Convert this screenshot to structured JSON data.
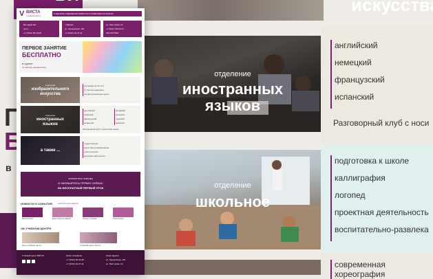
{
  "background": {
    "top_photo_text": "искусства",
    "left": {
      "logo_text": "ВИСТ",
      "big_line_1": "П",
      "big_line_2": "Б",
      "small_text": "в"
    },
    "section_languages": {
      "caption_small": "отделение",
      "caption_line_1": "иностранных",
      "caption_line_2": "языков",
      "items": [
        "английский",
        "немецкий",
        "французский",
        "испанский"
      ],
      "club": "Разговорный клуб с носи"
    },
    "section_school": {
      "caption_small": "отделение",
      "caption_big": "школьное",
      "items": [
        "подготовка к школе",
        "каллиграфия",
        "логопед",
        "проектная деятельность",
        "воспитательно-развлека"
      ]
    },
    "section_bottom": {
      "item": "современная хореография"
    }
  },
  "mini": {
    "logo": {
      "letter": "V",
      "title": "ВИСТА",
      "subtitle": "учебный центр"
    },
    "nav_items": "О ЦЕНТРЕ  ОТДЕЛЕНИЯ  НОВОСТИ И СОБЫТИЯ  КОНТАКТЫ",
    "contacts": [
      {
        "line1": "Мы ждём вас",
        "line2": "пн-пт",
        "line3": "+7 (3412) 95-18-38"
      },
      {
        "line1": "г. Ижевск",
        "line2": "ул. Пушкинская, 115",
        "line3": "+7 (3412) 22-27-11"
      },
      {
        "line1": "ул. Пастухова, 13",
        "line2": "+7 (912) 753-24-27",
        "line3": "ИНСТАГРАМ"
      }
    ],
    "hero": {
      "line1": "ПЕРВОЕ ЗАНЯТИЕ",
      "line2": "БЕСПЛАТНО",
      "line3": "в группе",
      "line4": "по любому направлению"
    },
    "sec_art": {
      "caption_small": "отделение",
      "caption_line_1": "изобразительного",
      "caption_line_2": "искусства",
      "items": [
        "рисование (4-16 лет)",
        "口 пастели живопись",
        "профессиональные курсы"
      ]
    },
    "sec_lang": {
      "caption_small": "отделение",
      "caption_line_1": "иностранных",
      "caption_line_2": "языков",
      "items_a": [
        "английский",
        "немецкий",
        "французский",
        "испанский"
      ],
      "items_b": [
        "китайский",
        "японский",
        "турецкий",
        "арабский"
      ],
      "club": "Разговорный клуб с носителем языка"
    },
    "sec_more": {
      "caption": "а также ...",
      "items": [
        "студия бисера",
        "курсы фотографирования",
        "робототехника",
        "актерское мастерство"
      ]
    },
    "promo": {
      "line1": "ЗАПИШИТЕСЬ ЗАРАНЕЕ",
      "line2": "И ЗАПИШИТЕСЬ ПРЯМО СЕЙЧАС",
      "line3": "НА БЕСПЛАТНЫЙ ПЕРВЫЙ УРОК"
    },
    "news": {
      "title": "НОВОСТИ И СОБЫТИЯ",
      "link": "смотреть все новости",
      "items": [
        "Мастер-класс",
        "День открытых дверей",
        "Концерт учеников",
        "Новый набор"
      ]
    },
    "about": {
      "title": "ОБ УЧЕБНОМ ЦЕНТРЕ",
      "items": [
        "Наш учебный центр",
        "Учебный центр Виста"
      ]
    },
    "footer": {
      "col1": "Учебный центр ВИСТА",
      "col2": "Наши телефоны",
      "col3": "Наши адреса",
      "phone1": "+7 (3412) 95-18-38",
      "phone2": "+7 (3412) 22-27-11",
      "addr1": "ул. Пушкинская, 115",
      "addr2": "ул. Пастухова, 13"
    }
  }
}
